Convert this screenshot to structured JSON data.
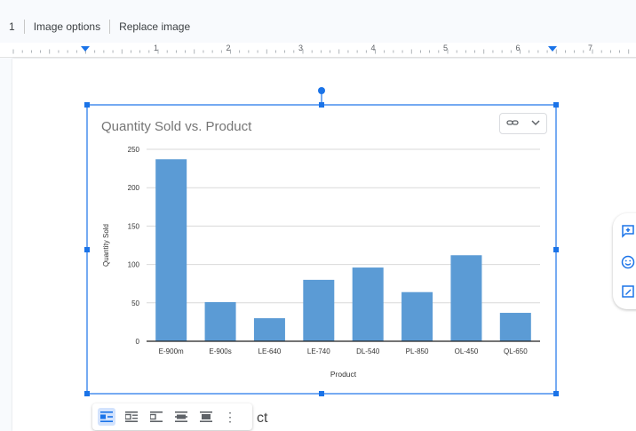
{
  "toolbar": {
    "leading_fragment": "1",
    "image_options": "Image options",
    "replace_image": "Replace image"
  },
  "ruler": {
    "numbers": [
      "1",
      "2",
      "3",
      "4",
      "5",
      "6",
      "7"
    ]
  },
  "chart_data": {
    "type": "bar",
    "title": "Quantity Sold vs. Product",
    "xlabel": "Product",
    "ylabel": "Quantity Sold",
    "categories": [
      "E-900m",
      "E-900s",
      "LE-640",
      "LE-740",
      "DL-540",
      "PL-850",
      "OL-450",
      "QL-650"
    ],
    "values": [
      237,
      51,
      30,
      80,
      96,
      64,
      112,
      37
    ],
    "ylim": [
      0,
      250
    ],
    "yticks": [
      0,
      50,
      100,
      150,
      200,
      250
    ],
    "bar_color": "#5b9bd5",
    "grid": true,
    "legend": "none"
  },
  "link_control": {
    "icon": "link-icon",
    "chevron": "chevron-down-icon"
  },
  "side_panel": [
    "add-comment-icon",
    "emoji-icon",
    "suggest-edit-icon"
  ],
  "image_toolbar": {
    "buttons": [
      "inline",
      "wrap-text",
      "break-text",
      "behind-text",
      "in-front-of-text"
    ],
    "active": "inline",
    "more": "⋮"
  },
  "body_text_fragment": "ct",
  "colors": {
    "selection": "#1a73e8",
    "accent": "#1a73e8"
  }
}
